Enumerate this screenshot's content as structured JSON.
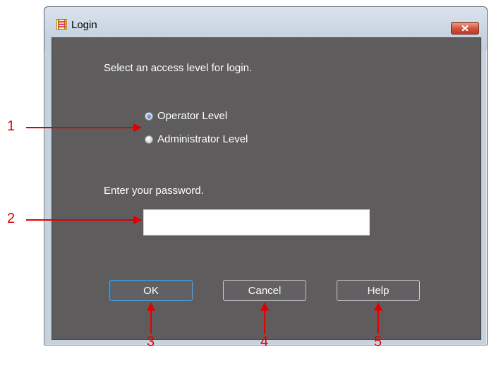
{
  "window": {
    "title": "Login",
    "icon": "ladder-icon"
  },
  "dialog": {
    "access_prompt": "Select an access level for login.",
    "access_levels": [
      {
        "label": "Operator Level",
        "selected": true
      },
      {
        "label": "Administrator Level",
        "selected": false
      }
    ],
    "password_prompt": "Enter your password.",
    "password_value": ""
  },
  "buttons": {
    "ok": "OK",
    "cancel": "Cancel",
    "help": "Help"
  },
  "callouts": [
    "1",
    "2",
    "3",
    "4",
    "5"
  ],
  "colors": {
    "dialog_background": "#5e5c5d",
    "callout": "#e00000",
    "close_button": "#c94a33"
  }
}
